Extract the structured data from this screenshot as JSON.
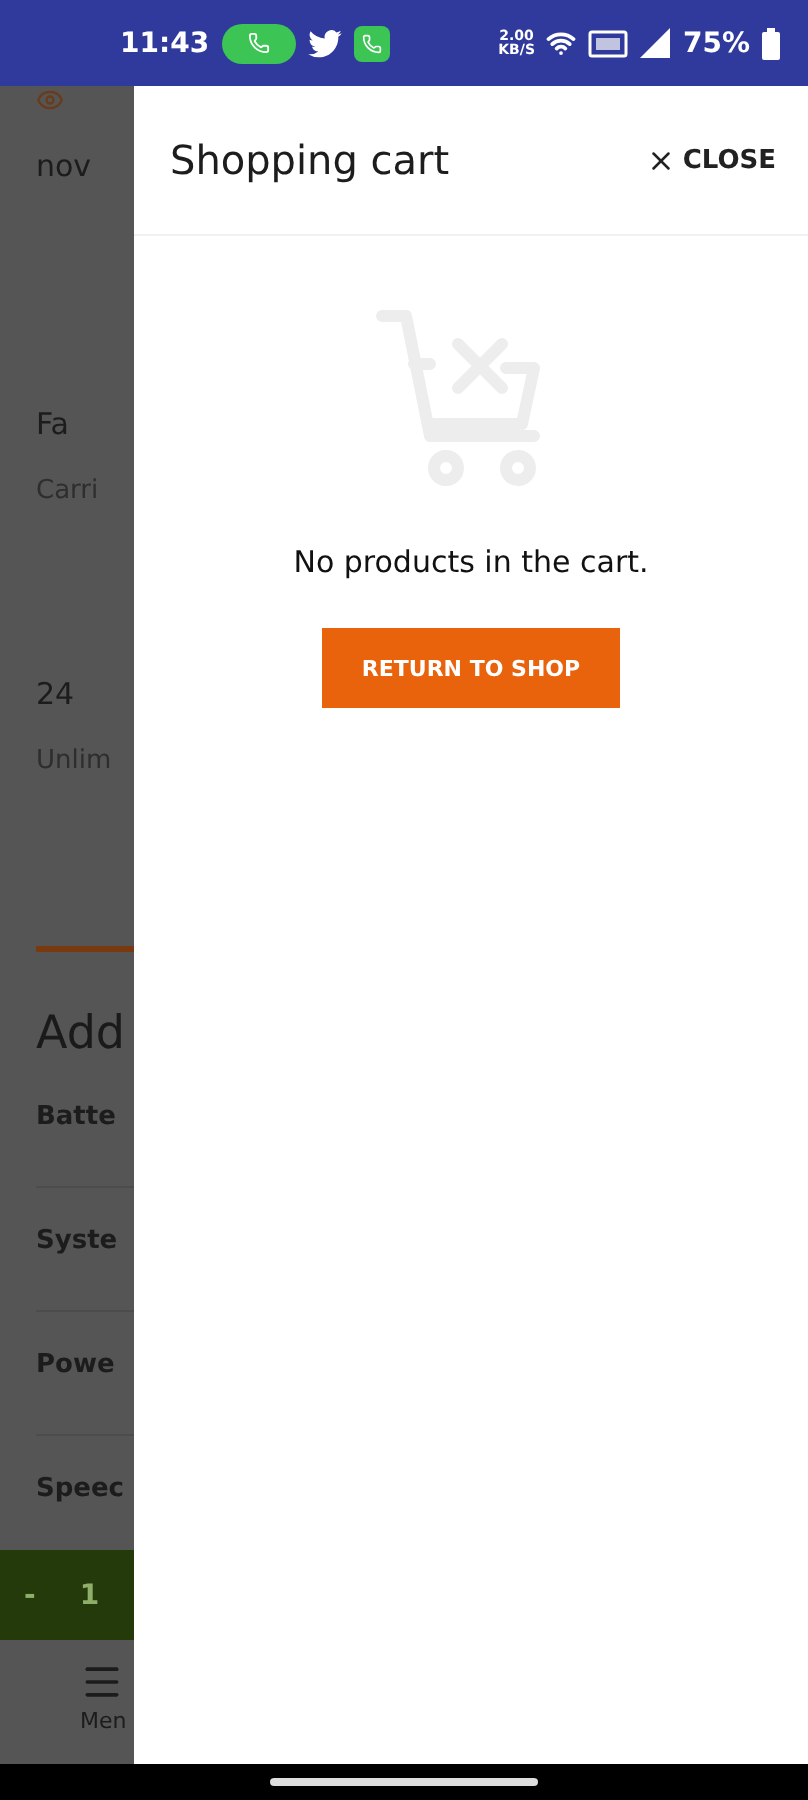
{
  "status_bar": {
    "time": "11:43",
    "net_speed_value": "2.00",
    "net_speed_unit": "KB/S",
    "battery": "75%"
  },
  "background_page": {
    "intro_text": "nov",
    "features": [
      {
        "title": "Fa",
        "text": "Carri"
      },
      {
        "title": "24",
        "text": "Unlim"
      }
    ],
    "addons_title": "Add",
    "addon_rows": [
      "Batte",
      "Syste",
      "Powe",
      "Speec"
    ],
    "quantity": {
      "minus": "-",
      "value": "1"
    },
    "nav_label": "Men"
  },
  "drawer": {
    "title": "Shopping cart",
    "close_label": "CLOSE",
    "empty_message": "No products in the cart.",
    "button": "RETURN TO SHOP"
  }
}
